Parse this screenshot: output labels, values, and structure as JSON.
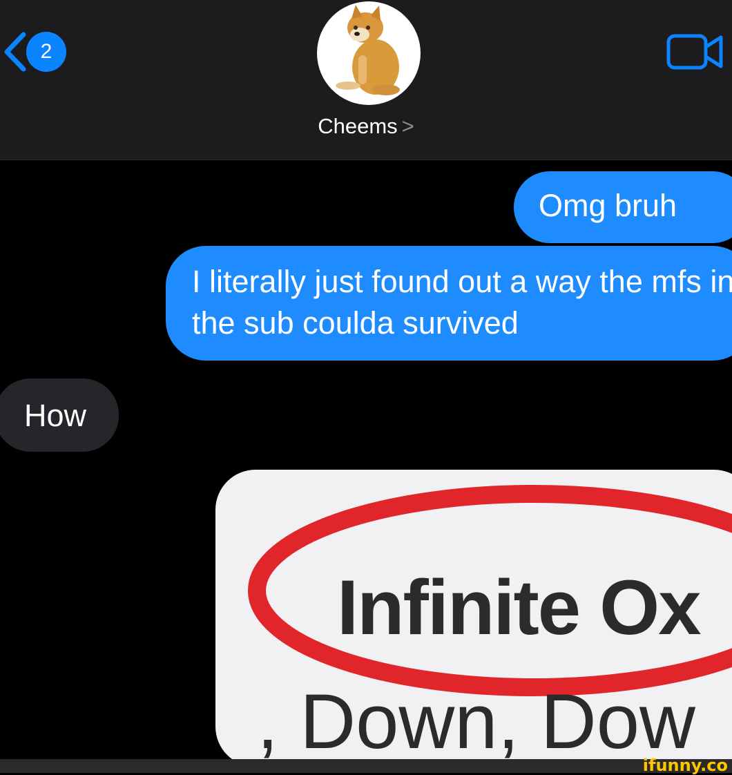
{
  "header": {
    "back_count": "2",
    "contact_name": "Cheems",
    "contact_chevron": ">"
  },
  "messages": [
    {
      "direction": "outgoing",
      "text": "Omg  bruh"
    },
    {
      "direction": "outgoing",
      "text": "I literally just found out a way the mfs in the sub coulda survived"
    },
    {
      "direction": "incoming",
      "text": "How"
    },
    {
      "direction": "outgoing",
      "type": "image",
      "image_text": [
        "Infinite Ox",
        ", Down, Dow"
      ]
    }
  ],
  "watermark": "ifunny.co",
  "colors": {
    "accent": "#0a84ff",
    "outgoing_bubble": "#1e8bff",
    "incoming_bubble": "#26252a",
    "header_bg": "#1c1c1e",
    "highlight_circle": "#e0262b"
  }
}
